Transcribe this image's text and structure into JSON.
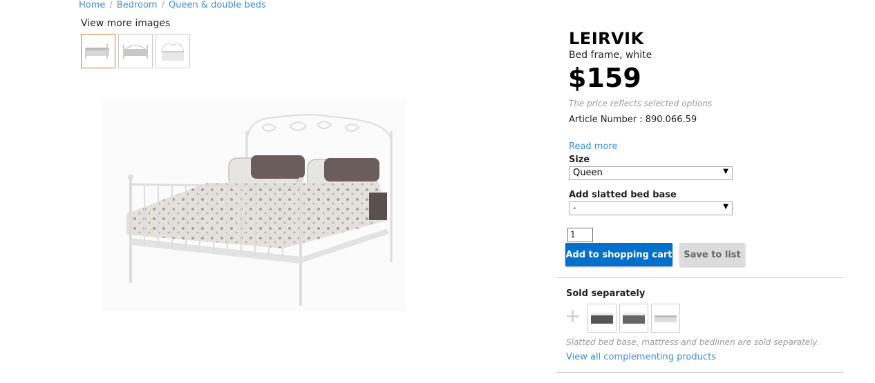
{
  "breadcrumb": {
    "items": [
      "Home",
      "Bedroom",
      "Queen & double beds"
    ],
    "separator": "/"
  },
  "gallery": {
    "view_more_label": "View more images",
    "thumbnails": [
      "bed-thumbnail-1",
      "bed-thumbnail-2",
      "bed-thumbnail-3"
    ],
    "active_index": 0
  },
  "product": {
    "name": "LEIRVIK",
    "description": "Bed frame, white",
    "price": "$159",
    "price_note": "The price reflects selected options",
    "article_label": "Article Number : 890.066.59",
    "read_more": "Read more"
  },
  "options": {
    "size_label": "Size",
    "size_value": "Queen",
    "base_label": "Add slatted bed base",
    "base_value": "-"
  },
  "cart": {
    "quantity": "1",
    "add_label": "Add to shopping cart",
    "save_label": "Save to list"
  },
  "sold_separately": {
    "heading": "Sold separately",
    "plus": "+",
    "items": [
      "mattress-thumbnail-1",
      "mattress-thumbnail-2",
      "slatted-base-thumbnail"
    ],
    "note": "Slatted bed base, mattress and bedlinen are sold separately.",
    "view_all": "View all complementing products"
  },
  "colors": {
    "link": "#3b8fd9",
    "primary_button": "#0070cc",
    "secondary_button": "#dcdcdc",
    "active_thumb_border": "#d07a2a"
  }
}
